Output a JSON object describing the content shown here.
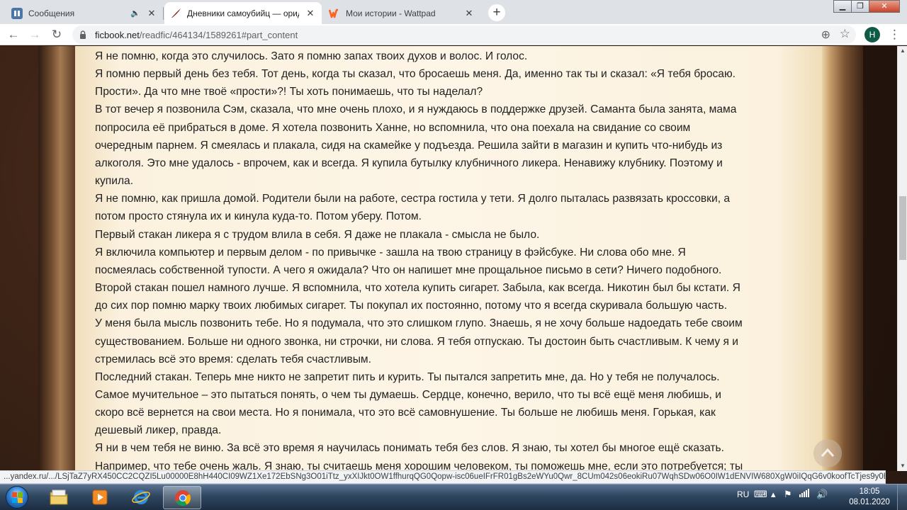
{
  "browser": {
    "tabs": [
      {
        "title": "Сообщения",
        "favicon": "vk-messages-icon",
        "favicon_color": "#4a76a8",
        "muted": true
      },
      {
        "title": "Дневники самоубийц — ориджиналы",
        "favicon": "ficbook-quill-icon",
        "favicon_color": "#8b1e1e",
        "active": true
      },
      {
        "title": "Мои истории - Wattpad",
        "favicon": "wattpad-icon",
        "favicon_color": "#ff6122"
      }
    ],
    "new_tab_glyph": "+",
    "address": {
      "host": "ficbook.net",
      "path": "/readfic/464134/1589261#part_content"
    },
    "avatar_letter": "H",
    "avatar_color": "#0f5b47"
  },
  "story": {
    "lines": [
      "Я не помню, когда это случилось. Зато я помню запах твоих духов и волос. И голос.",
      "Я помню первый день без тебя. Тот день, когда ты сказал, что бросаешь меня. Да, именно так ты и сказал: «Я тебя бросаю.",
      "Прости». Да что мне твоё «прости»?! Ты хоть понимаешь, что ты наделал?",
      "В тот вечер я позвонила Сэм, сказала, что мне очень плохо, и я нуждаюсь в поддержке друзей. Саманта была занята, мама",
      "попросила её прибраться в доме. Я хотела позвонить Ханне, но вспомнила, что она поехала на свидание со своим",
      "очередным парнем. Я смеялась и плакала, сидя на скамейке у подъезда. Решила зайти в магазин и купить что-нибудь из",
      "алкоголя. Это мне удалось - впрочем, как и всегда. Я купила бутылку клубничного ликера. Ненавижу клубнику. Поэтому и",
      "купила.",
      "Я не помню, как пришла домой. Родители были на работе, сестра гостила у тети. Я долго пыталась развязать кроссовки, а",
      "потом просто стянула их и кинула куда-то. Потом уберу. Потом.",
      "Первый стакан ликера я с трудом влила в себя. Я даже не плакала - смысла не было.",
      "Я включила компьютер и первым делом - по привычке - зашла на твою страницу в фэйсбуке. Ни слова обо мне. Я",
      "посмеялась собственной тупости. А чего я ожидала? Что он напишет мне прощальное письмо в сети? Ничего подобного.",
      "Второй стакан пошел намного лучше. Я вспомнила, что хотела купить сигарет. Забыла, как всегда. Никотин был бы кстати. Я",
      "до сих пор помню марку твоих любимых сигарет. Ты покупал их постоянно, потому что я всегда скуривала большую часть.",
      "У меня была мысль позвонить тебе. Но я подумала, что это слишком глупо. Знаешь, я не хочу больше надоедать тебе своим",
      "существованием. Больше ни одного звонка, ни строчки, ни слова. Я тебя отпускаю. Ты достоин быть счастливым. К чему я и",
      "стремилась всё это время: сделать тебя счастливым.",
      "Последний стакан. Теперь мне никто не запретит пить и курить. Ты пытался запретить мне, да. Но у тебя не получалось.",
      "Самое мучительное – это пытаться понять, о чем ты думаешь. Сердце, конечно, верило, что ты всё ещё меня любишь, и",
      "скоро всё вернется на свои места. Но я понимала, что это всё самовнушение. Ты больше не любишь меня. Горькая, как",
      "дешевый ликер, правда.",
      "Я ни в чем тебя не виню. За всё это время я научилась понимать тебя без слов. Я знаю, ты хотел бы многое ещё сказать.",
      "Например, что тебе очень жаль. Я знаю, ты считаешь меня хорошим человеком, ты поможешь мне, если это потребуется; ты"
    ]
  },
  "status_bar": {
    "link_preview": "...yandex.ru/.../LSjTaZ7yRX450CC2CQZI5Lu00000E8hH440CI09WZ1Xe172EbSNg3O01iTtz_yxXIJkt0OW1ffhurqQG0Qopw-isc06ueIFrFR01gBs2eWYu0Qwr_8CUm042s06eokiRu07WqhSDw06O0IW1dENVIW680XgW0iIQqG6v0koofTcTjes9y0B4vgM43IW2..."
  },
  "taskbar": {
    "language": "RU",
    "time": "18:05",
    "date": "08.01.2020",
    "pinned": [
      "explorer-folder-icon",
      "media-player-icon",
      "internet-explorer-icon",
      "chrome-icon"
    ]
  },
  "colors": {
    "page_text": "#222222",
    "paper": "#fdf5e6",
    "frame_wood": "#6f4a2f",
    "taskbar": "#2f4660"
  }
}
